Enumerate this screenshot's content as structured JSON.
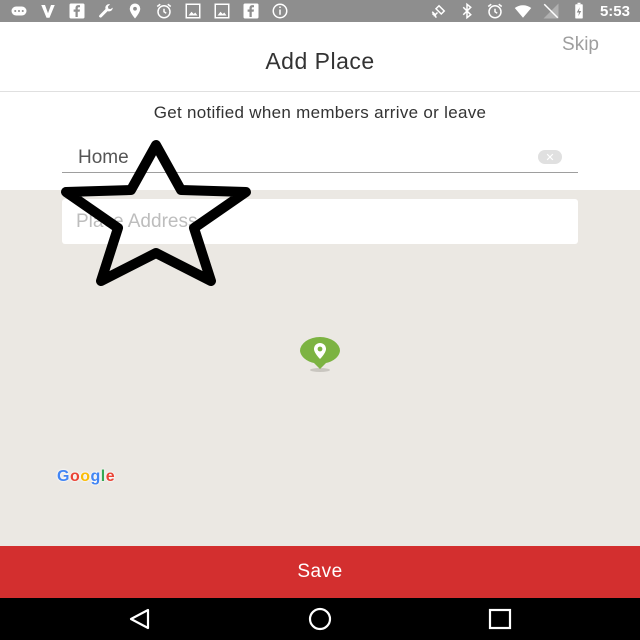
{
  "status_bar": {
    "icons_left": [
      "keyboard-icon",
      "v-icon",
      "facebook-icon",
      "wrench-icon",
      "location-icon",
      "alarm-icon",
      "photo-icon",
      "photo-icon",
      "facebook-icon",
      "info-icon"
    ],
    "icons_right": [
      "satellite-icon",
      "bluetooth-icon",
      "alarm-icon",
      "wifi-icon",
      "signal-icon",
      "battery-icon"
    ],
    "time": "5:53"
  },
  "header": {
    "title": "Add Place",
    "skip_label": "Skip"
  },
  "form": {
    "subtitle": "Get notified when members arrive or leave",
    "name_value": "Home",
    "address_placeholder": "Place Address"
  },
  "map": {
    "google_letters": [
      "G",
      "o",
      "o",
      "g",
      "l",
      "e"
    ],
    "pin_color": "#7cb342"
  },
  "save_label": "Save",
  "colors": {
    "accent": "#d32f2f",
    "map_background": "#ebe8e3",
    "status_bar": "#8e8e8e"
  }
}
